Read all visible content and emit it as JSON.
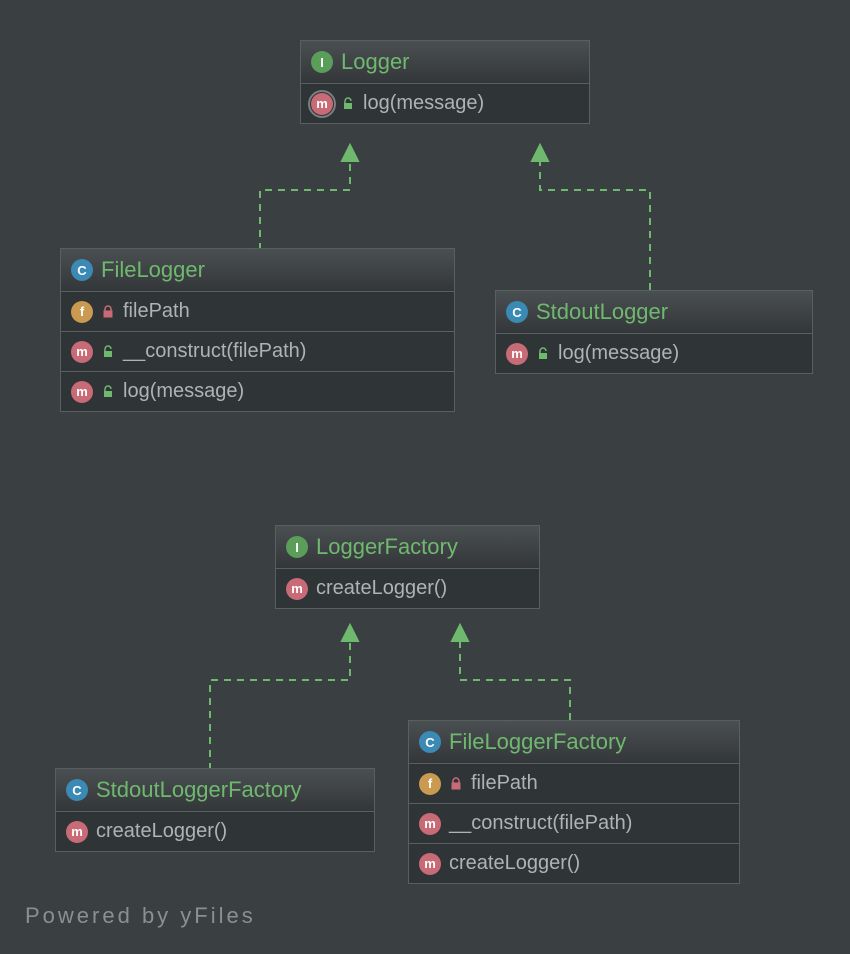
{
  "footer": "Powered by yFiles",
  "badge_letters": {
    "interface": "I",
    "class": "C",
    "method": "m",
    "field": "f"
  },
  "classes": {
    "logger": {
      "kind": "interface",
      "name": "Logger",
      "members": [
        {
          "badge": "method_abstract",
          "visibility": "public",
          "text": "log(message)"
        }
      ]
    },
    "fileLogger": {
      "kind": "class",
      "name": "FileLogger",
      "members": [
        {
          "badge": "field",
          "visibility": "private",
          "text": "filePath"
        },
        {
          "badge": "method",
          "visibility": "public",
          "text": "__construct(filePath)"
        },
        {
          "badge": "method",
          "visibility": "public",
          "text": "log(message)"
        }
      ]
    },
    "stdoutLogger": {
      "kind": "class",
      "name": "StdoutLogger",
      "members": [
        {
          "badge": "method",
          "visibility": "public",
          "text": "log(message)"
        }
      ]
    },
    "loggerFactory": {
      "kind": "interface",
      "name": "LoggerFactory",
      "members": [
        {
          "badge": "method",
          "visibility": null,
          "text": "createLogger()"
        }
      ]
    },
    "stdoutLoggerFactory": {
      "kind": "class",
      "name": "StdoutLoggerFactory",
      "members": [
        {
          "badge": "method",
          "visibility": null,
          "text": "createLogger()"
        }
      ]
    },
    "fileLoggerFactory": {
      "kind": "class",
      "name": "FileLoggerFactory",
      "members": [
        {
          "badge": "field",
          "visibility": "private",
          "text": "filePath"
        },
        {
          "badge": "method",
          "visibility": null,
          "text": "__construct(filePath)"
        },
        {
          "badge": "method",
          "visibility": null,
          "text": "createLogger()"
        }
      ]
    }
  },
  "relations": [
    {
      "from": "fileLogger",
      "to": "logger",
      "type": "realization"
    },
    {
      "from": "stdoutLogger",
      "to": "logger",
      "type": "realization"
    },
    {
      "from": "stdoutLoggerFactory",
      "to": "loggerFactory",
      "type": "realization"
    },
    {
      "from": "fileLoggerFactory",
      "to": "loggerFactory",
      "type": "realization"
    }
  ]
}
